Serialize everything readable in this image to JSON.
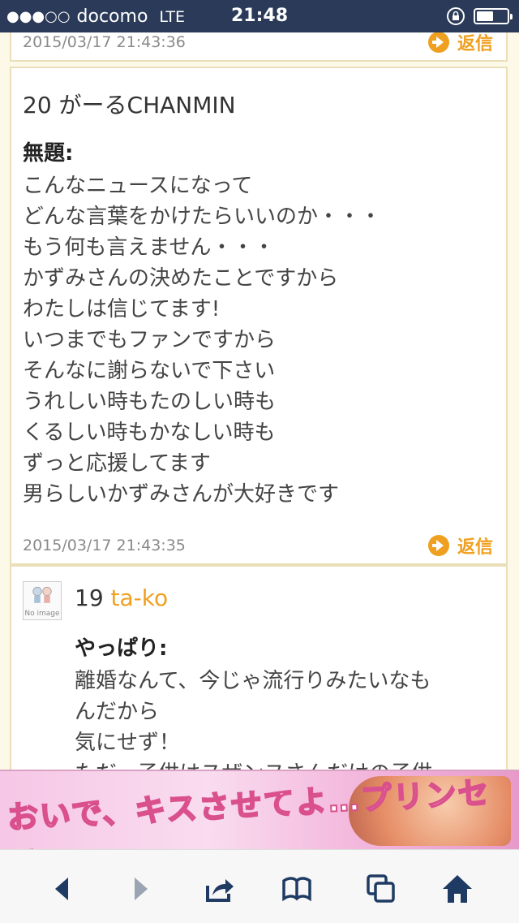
{
  "status": {
    "carrier": "docomo",
    "network": "LTE",
    "time": "21:48"
  },
  "posts": [
    {
      "timestamp": "2015/03/17 21:43:36",
      "reply_label": "返信"
    },
    {
      "number": "20",
      "author": "がーるCHANMIN",
      "subject": "無題:",
      "body": "こんなニュースになって\nどんな言葉をかけたらいいのか・・・\nもう何も言えません・・・\nかずみさんの決めたことですから\nわたしは信じてます!\nいつまでもファンですから\nそんなに謝らないで下さい\nうれしい時もたのしい時も\nくるしい時もかなしい時も\nずっと応援してます\n男らしいかずみさんが大好きです",
      "timestamp": "2015/03/17 21:43:35",
      "reply_label": "返信"
    },
    {
      "number": "19",
      "author": "ta-ko",
      "avatar_text": "No image",
      "subject": "やっぱり:",
      "body": "離婚なんて、今じゃ流行りみたいなも\nんだから\n気にせず！\nただ、子供はスザンヌさんだけの子供"
    }
  ],
  "ad": {
    "text": "おいで、キスさせてよ…プリンセス"
  },
  "toolbar": {
    "icons": [
      "back-icon",
      "forward-icon",
      "share-icon",
      "bookmarks-icon",
      "tabs-icon",
      "home-icon"
    ]
  },
  "colors": {
    "accent": "#f0a020",
    "statusbar": "#2a3a58",
    "background": "#fdf9e8"
  }
}
